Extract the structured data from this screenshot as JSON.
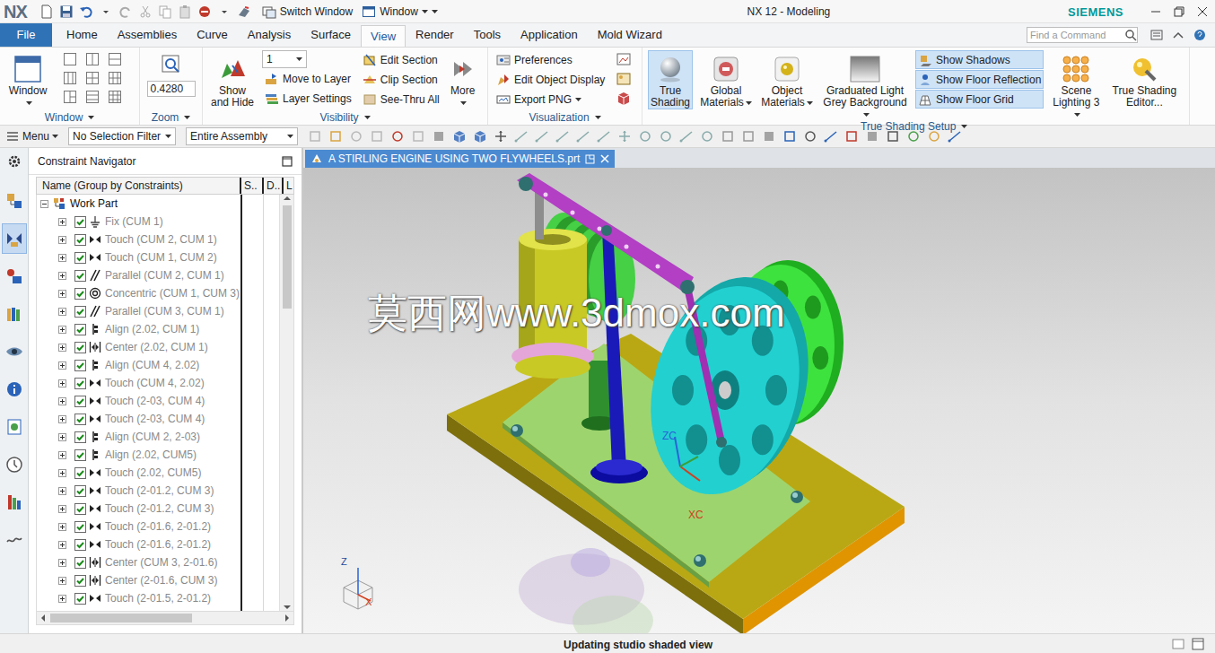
{
  "title_bar": {
    "logo": "NX",
    "switch_window": "Switch Window",
    "window_menu": "Window",
    "title": "NX 12 - Modeling",
    "brand": "SIEMENS"
  },
  "tabs": [
    {
      "label": "File",
      "selected": false,
      "kind": "file"
    },
    {
      "label": "Home",
      "selected": false,
      "kind": "tab"
    },
    {
      "label": "Assemblies",
      "selected": false,
      "kind": "tab"
    },
    {
      "label": "Curve",
      "selected": false,
      "kind": "tab"
    },
    {
      "label": "Analysis",
      "selected": false,
      "kind": "tab"
    },
    {
      "label": "Surface",
      "selected": false,
      "kind": "tab"
    },
    {
      "label": "View",
      "selected": true,
      "kind": "tab"
    },
    {
      "label": "Render",
      "selected": false,
      "kind": "tab"
    },
    {
      "label": "Tools",
      "selected": false,
      "kind": "tab"
    },
    {
      "label": "Application",
      "selected": false,
      "kind": "tab"
    },
    {
      "label": "Mold Wizard",
      "selected": false,
      "kind": "tab"
    }
  ],
  "search": {
    "placeholder": "Find a Command"
  },
  "ribbon": {
    "window_group": {
      "button": "Window",
      "label": "Window"
    },
    "zoom_group": {
      "value": "0.4280",
      "label": "Zoom"
    },
    "visibility_group": {
      "show_hide": "Show and Hide",
      "layer": "1",
      "layer_items": [
        "Move to Layer",
        "Layer Settings"
      ],
      "section_items": [
        "Edit Section",
        "Clip Section",
        "See-Thru All"
      ],
      "more": "More",
      "label": "Visibility"
    },
    "visualization_group": {
      "items": [
        {
          "label": "Preferences",
          "dropdown": false
        },
        {
          "label": "Edit Object Display",
          "dropdown": false
        },
        {
          "label": "Export PNG",
          "dropdown": true
        }
      ],
      "label": "Visualization"
    },
    "true_shading_group": {
      "true_shading": {
        "label": "True Shading",
        "on": true
      },
      "materials": [
        {
          "label": "Global Materials",
          "dropdown": true
        },
        {
          "label": "Object Materials",
          "dropdown": true
        },
        {
          "label": "Graduated Light Grey Background",
          "dropdown": true
        }
      ],
      "toggles": [
        {
          "label": "Show Shadows",
          "on": true
        },
        {
          "label": "Show Floor Reflection",
          "on": true
        },
        {
          "label": "Show Floor Grid",
          "on": true
        }
      ],
      "scene_lighting": "Scene Lighting 3",
      "editor": "True Shading Editor...",
      "label": "True Shading Setup"
    }
  },
  "toolbar": {
    "menu": "Menu",
    "selection_filter": "No Selection Filter",
    "scope": "Entire Assembly"
  },
  "resource_bar": {
    "items": [
      {
        "selected": false
      },
      {
        "selected": true
      },
      {
        "selected": false
      },
      {
        "selected": false
      },
      {
        "selected": false
      },
      {
        "selected": false
      },
      {
        "selected": false
      },
      {
        "selected": false
      },
      {
        "selected": false
      },
      {
        "selected": false
      }
    ]
  },
  "navigator": {
    "title": "Constraint Navigator",
    "columns": [
      "Name (Group by Constraints)",
      "S..",
      "D..",
      "L"
    ],
    "root": {
      "label": "Work Part",
      "expanded": true
    },
    "rows": [
      {
        "label": "Fix (CUM 1)",
        "kind": "fix",
        "checked": true,
        "expanded": false,
        "greyed": true
      },
      {
        "label": "Touch (CUM 2, CUM 1)",
        "kind": "touch",
        "checked": true,
        "expanded": false,
        "greyed": true
      },
      {
        "label": "Touch (CUM 1, CUM 2)",
        "kind": "touch",
        "checked": true,
        "expanded": false,
        "greyed": true
      },
      {
        "label": "Parallel (CUM 2, CUM 1)",
        "kind": "parallel",
        "checked": true,
        "expanded": false,
        "greyed": true
      },
      {
        "label": "Concentric (CUM 1, CUM 3)",
        "kind": "concentric",
        "checked": true,
        "expanded": false,
        "greyed": true
      },
      {
        "label": "Parallel (CUM 3, CUM 1)",
        "kind": "parallel",
        "checked": true,
        "expanded": false,
        "greyed": true
      },
      {
        "label": "Align (2.02, CUM 1)",
        "kind": "align",
        "checked": true,
        "expanded": false,
        "greyed": true
      },
      {
        "label": "Center (2.02, CUM 1)",
        "kind": "center",
        "checked": true,
        "expanded": false,
        "greyed": true
      },
      {
        "label": "Align (CUM 4, 2.02)",
        "kind": "align",
        "checked": true,
        "expanded": false,
        "greyed": true
      },
      {
        "label": "Touch (CUM 4, 2.02)",
        "kind": "touch",
        "checked": true,
        "expanded": false,
        "greyed": true
      },
      {
        "label": "Touch (2-03, CUM 4)",
        "kind": "touch",
        "checked": true,
        "expanded": false,
        "greyed": true
      },
      {
        "label": "Touch (2-03, CUM 4)",
        "kind": "touch",
        "checked": true,
        "expanded": false,
        "greyed": true
      },
      {
        "label": "Align (CUM 2, 2-03)",
        "kind": "align",
        "checked": true,
        "expanded": false,
        "greyed": true
      },
      {
        "label": "Align (2.02, CUM5)",
        "kind": "align",
        "checked": true,
        "expanded": false,
        "greyed": true
      },
      {
        "label": "Touch (2.02, CUM5)",
        "kind": "touch",
        "checked": true,
        "expanded": false,
        "greyed": true
      },
      {
        "label": "Touch (2-01.2, CUM 3)",
        "kind": "touch",
        "checked": true,
        "expanded": false,
        "greyed": true
      },
      {
        "label": "Touch (2-01.2, CUM 3)",
        "kind": "touch",
        "checked": true,
        "expanded": false,
        "greyed": true
      },
      {
        "label": "Touch (2-01.6, 2-01.2)",
        "kind": "touch",
        "checked": true,
        "expanded": false,
        "greyed": true
      },
      {
        "label": "Touch (2-01.6, 2-01.2)",
        "kind": "touch",
        "checked": true,
        "expanded": false,
        "greyed": true
      },
      {
        "label": "Center (CUM 3, 2-01.6)",
        "kind": "center",
        "checked": true,
        "expanded": false,
        "greyed": true
      },
      {
        "label": "Center (2-01.6, CUM 3)",
        "kind": "center",
        "checked": true,
        "expanded": false,
        "greyed": true
      },
      {
        "label": "Touch (2-01.5, 2-01.2)",
        "kind": "touch",
        "checked": true,
        "expanded": false,
        "greyed": true
      }
    ]
  },
  "graphics": {
    "tab": "A STIRLING ENGINE USING TWO FLYWHEELS.prt",
    "watermark": "莫西网www.3dmox.com",
    "axis_labels": [
      "ZC",
      "XC"
    ],
    "triad_labels": [
      "Z",
      "X"
    ]
  },
  "status_bar": {
    "message": "Updating studio shaded view"
  }
}
